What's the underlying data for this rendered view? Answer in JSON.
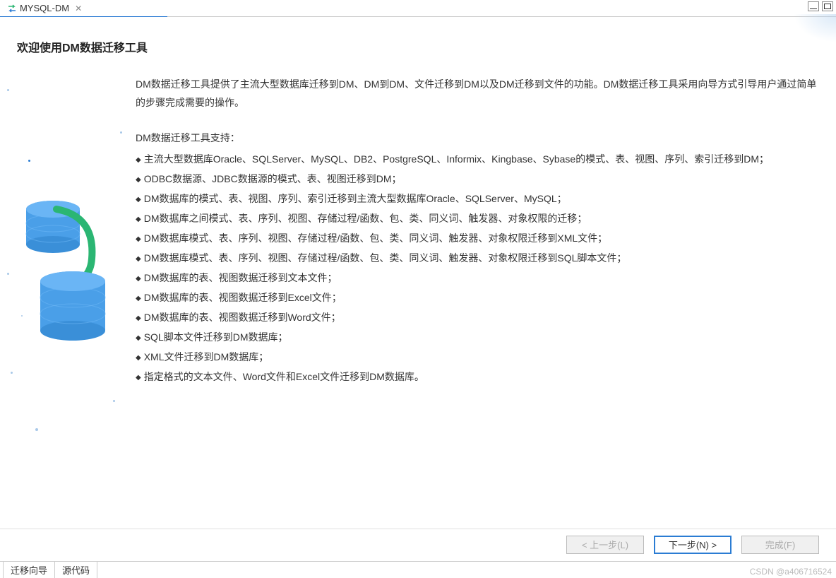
{
  "tab": {
    "title": "MYSQL-DM",
    "close_symbol": "✕"
  },
  "header": {
    "title": "欢迎使用DM数据迁移工具"
  },
  "content": {
    "intro": "DM数据迁移工具提供了主流大型数据库迁移到DM、DM到DM、文件迁移到DM以及DM迁移到文件的功能。DM数据迁移工具采用向导方式引导用户通过简单的步骤完成需要的操作。",
    "support_title": "DM数据迁移工具支持：",
    "features": [
      "主流大型数据库Oracle、SQLServer、MySQL、DB2、PostgreSQL、Informix、Kingbase、Sybase的模式、表、视图、序列、索引迁移到DM；",
      "ODBC数据源、JDBC数据源的模式、表、视图迁移到DM；",
      "DM数据库的模式、表、视图、序列、索引迁移到主流大型数据库Oracle、SQLServer、MySQL；",
      "DM数据库之间模式、表、序列、视图、存储过程/函数、包、类、同义词、触发器、对象权限的迁移；",
      "DM数据库模式、表、序列、视图、存储过程/函数、包、类、同义词、触发器、对象权限迁移到XML文件；",
      "DM数据库模式、表、序列、视图、存储过程/函数、包、类、同义词、触发器、对象权限迁移到SQL脚本文件；",
      "DM数据库的表、视图数据迁移到文本文件；",
      "DM数据库的表、视图数据迁移到Excel文件；",
      "DM数据库的表、视图数据迁移到Word文件；",
      "SQL脚本文件迁移到DM数据库；",
      "XML文件迁移到DM数据库；",
      "指定格式的文本文件、Word文件和Excel文件迁移到DM数据库。"
    ]
  },
  "buttons": {
    "prev": "< 上一步(L)",
    "next": "下一步(N) >",
    "finish": "完成(F)"
  },
  "bottom_tabs": {
    "wizard": "迁移向导",
    "source": "源代码"
  },
  "watermark": "CSDN @a406716524"
}
